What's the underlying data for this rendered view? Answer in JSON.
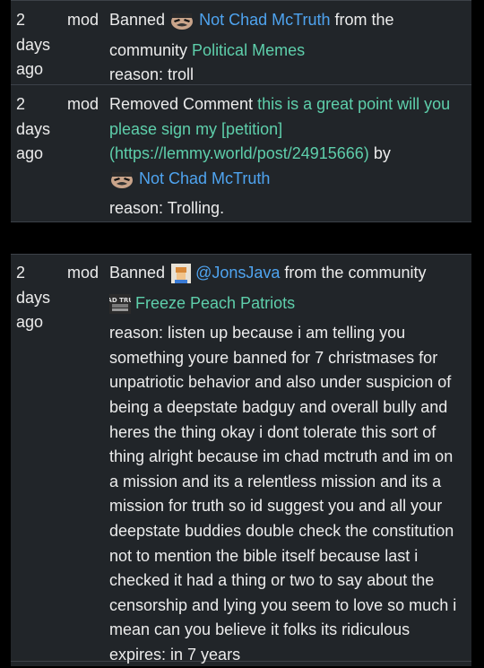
{
  "entries": [
    {
      "time": [
        "2",
        "days",
        "ago"
      ],
      "who": "mod",
      "action": "Banned",
      "user": "Not Chad McTruth",
      "from": "from the",
      "community_word": "community",
      "community": "Political Memes",
      "reason": "reason: troll"
    },
    {
      "time": [
        "2",
        "days",
        "ago"
      ],
      "who": "mod",
      "action": "Removed Comment",
      "comment_lines": [
        "this is a great point will you",
        "please sign my [petition]",
        "(https://lemmy.world/post/24915666)"
      ],
      "by": "by",
      "user": "Not Chad McTruth",
      "reason": "reason: Trolling."
    },
    {
      "time": [
        "2",
        "days",
        "ago"
      ],
      "who": "mod",
      "action": "Banned",
      "user": "@JonsJava",
      "from": "from the community",
      "community": "Freeze Peach Patriots",
      "community_icon_text": "CHAD TRUTH",
      "reason_lines": [
        "reason: listen up because i am telling you",
        "something youre banned for 7 christmases for",
        "unpatriotic behavior and also under suspicion of",
        "being a deepstate badguy and overall bully and",
        "heres the thing okay i dont tolerate this sort of",
        "thing alright because im chad mctruth and im on",
        "a mission and its a relentless mission and its a",
        "mission for truth so id suggest you and all your",
        "deepstate buddies double check the constitution",
        "not to mention the bible itself because last i",
        "checked it had a thing or two to say about the",
        "censorship and lying you seem to love so much i",
        "mean can you believe it folks its ridiculous"
      ],
      "expires": "expires: in 7 years"
    }
  ],
  "colors": {
    "link": "#5ecfab",
    "user": "#4fa4f0",
    "panel": "#212529"
  }
}
